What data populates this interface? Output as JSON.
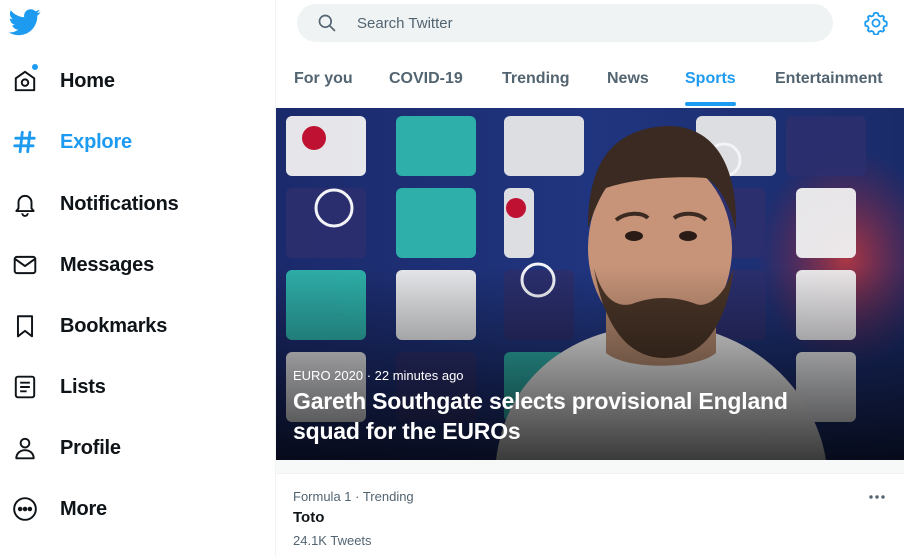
{
  "colors": {
    "accent": "#1d9bf0",
    "text": "#0f1419",
    "secondary": "#536471"
  },
  "sidebar": {
    "items": [
      {
        "label": "Home",
        "icon": "home-icon"
      },
      {
        "label": "Explore",
        "icon": "hashtag-icon",
        "active": true
      },
      {
        "label": "Notifications",
        "icon": "bell-icon"
      },
      {
        "label": "Messages",
        "icon": "envelope-icon"
      },
      {
        "label": "Bookmarks",
        "icon": "bookmark-icon"
      },
      {
        "label": "Lists",
        "icon": "list-icon"
      },
      {
        "label": "Profile",
        "icon": "person-icon"
      },
      {
        "label": "More",
        "icon": "more-circle-icon"
      }
    ]
  },
  "search": {
    "placeholder": "Search Twitter"
  },
  "tabs": [
    {
      "label": "For you"
    },
    {
      "label": "COVID-19"
    },
    {
      "label": "Trending"
    },
    {
      "label": "News"
    },
    {
      "label": "Sports",
      "active": true
    },
    {
      "label": "Entertainment"
    }
  ],
  "hero": {
    "meta": "EURO 2020 · 22 minutes ago",
    "headline": "Gareth Southgate selects provisional England squad for the EUROs"
  },
  "trend": {
    "meta": "Formula 1 · Trending",
    "name": "Toto",
    "count": "24.1K Tweets"
  }
}
